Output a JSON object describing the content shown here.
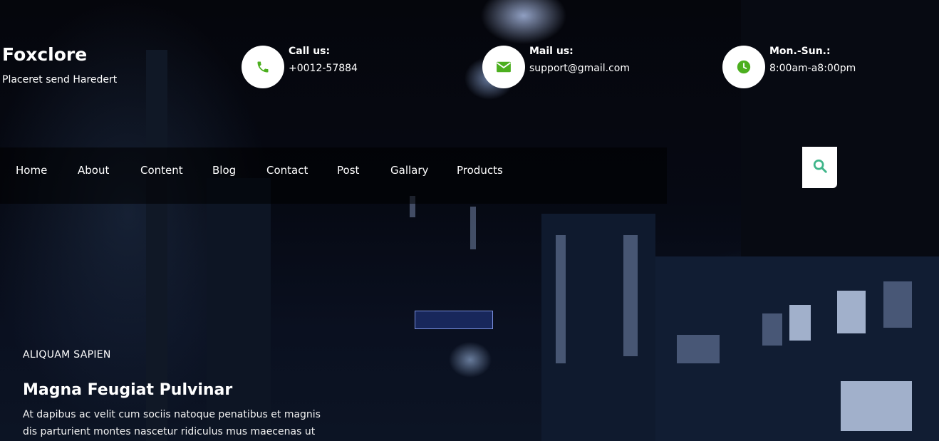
{
  "brand": {
    "name": "Foxclore",
    "tagline": "Placeret send Haredert"
  },
  "contacts": [
    {
      "icon": "phone-icon",
      "label": "Call us:",
      "value": "+0012-57884"
    },
    {
      "icon": "envelope-icon",
      "label": "Mail us:",
      "value": "support@gmail.com"
    },
    {
      "icon": "clock-icon",
      "label": "Mon.-Sun.:",
      "value": "8:00am-a8:00pm"
    }
  ],
  "nav": {
    "items": [
      "Home",
      "About",
      "Content",
      "Blog",
      "Contact",
      "Post",
      "Gallary",
      "Products"
    ],
    "search_icon": "search-icon"
  },
  "hero": {
    "kicker": "ALIQUAM SAPIEN",
    "headline": "Magna Feugiat Pulvinar",
    "body_line1": "At dapibus ac velit cum sociis natoque penatibus et magnis",
    "body_line2": "dis parturient montes nascetur ridiculus mus maecenas ut"
  },
  "colors": {
    "accent": "#4caf1f",
    "search_accent": "#3fb58a",
    "background": "#05060c",
    "text": "#ffffff"
  }
}
